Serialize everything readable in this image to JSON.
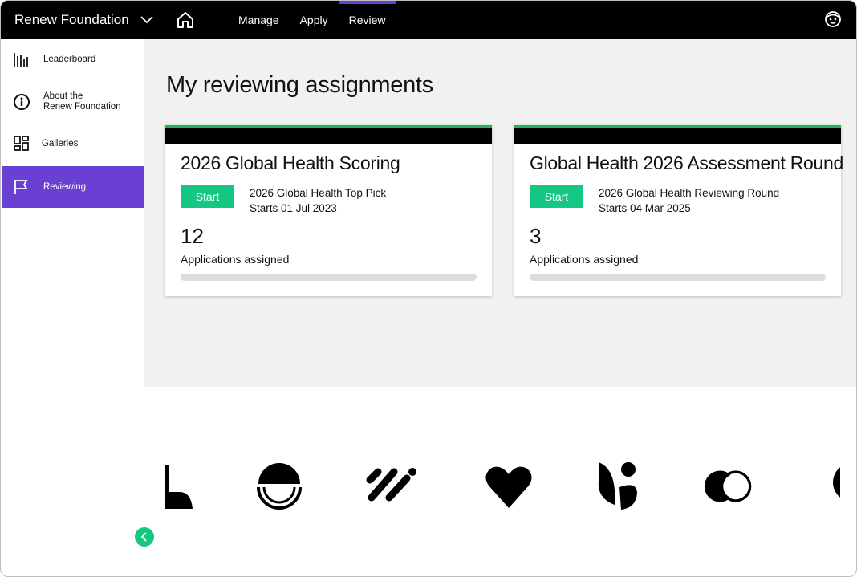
{
  "app": {
    "org_name": "Renew Foundation",
    "brand_color": "#6a40d4",
    "accent_color": "#16c784"
  },
  "topnav": {
    "items": [
      {
        "label": "Manage",
        "active": false
      },
      {
        "label": "Apply",
        "active": false
      },
      {
        "label": "Review",
        "active": true
      }
    ],
    "home_icon": "home-icon",
    "user_icon": "user-avatar-icon"
  },
  "sidebar": {
    "items": [
      {
        "label": "Leaderboard",
        "icon": "bar-chart-icon",
        "active": false
      },
      {
        "label": "About the\nRenew Foundation",
        "icon": "info-icon",
        "active": false
      },
      {
        "label": "Galleries",
        "icon": "gallery-icon",
        "active": false
      },
      {
        "label": "Reviewing",
        "icon": "flag-icon",
        "active": true
      }
    ]
  },
  "main": {
    "title": "My reviewing assignments",
    "cards": [
      {
        "title": "2026 Global Health Scoring",
        "button_label": "Start",
        "round_name": "2026 Global Health Top Pick",
        "round_date": "Starts 01 Jul 2023",
        "count": "12",
        "count_label": "Applications assigned",
        "progress": 0
      },
      {
        "title": "Global Health 2026 Assessment Round",
        "button_label": "Start",
        "round_name": "2026 Global Health Reviewing Round",
        "round_date": "Starts 04 Mar 2025",
        "count": "3",
        "count_label": "Applications assigned",
        "progress": 0
      }
    ]
  },
  "logo_strip": {
    "logos": [
      "partial-l-logo",
      "semicircle-logo",
      "slash-lines-logo",
      "heart-logo",
      "leaf-logo",
      "circles-logo",
      "partial-circle-logo"
    ]
  }
}
